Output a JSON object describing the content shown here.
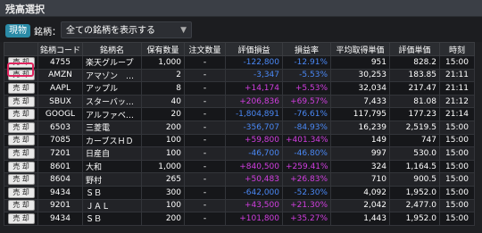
{
  "window": {
    "title": "残高選択"
  },
  "filter": {
    "badge": "現物",
    "label": "銘柄：",
    "selected": "全ての銘柄を表示する"
  },
  "columns": [
    "",
    "銘柄コード",
    "銘柄名",
    "保有数量",
    "注文数量",
    "評価損益",
    "損益率",
    "平均取得単価",
    "評価単価",
    "時刻"
  ],
  "sell_label": "売 却",
  "rows": [
    {
      "code": "4755",
      "name": "楽天グループ",
      "qty": "1,000",
      "order": "-",
      "pl": "-122,800",
      "rate": "-12.91%",
      "avg": "951",
      "eval": "828.2",
      "time": "15:00",
      "sign": "neg"
    },
    {
      "code": "AMZN",
      "name": "アマゾン　…",
      "qty": "2",
      "order": "-",
      "pl": "-3,347",
      "rate": "-5.53%",
      "avg": "30,253",
      "eval": "183.85",
      "time": "21:11",
      "sign": "neg"
    },
    {
      "code": "AAPL",
      "name": "アップル",
      "qty": "8",
      "order": "-",
      "pl": "+14,174",
      "rate": "+5.53%",
      "avg": "32,034",
      "eval": "217.47",
      "time": "21:11",
      "sign": "pos"
    },
    {
      "code": "SBUX",
      "name": "スターバッ…",
      "qty": "40",
      "order": "-",
      "pl": "+206,836",
      "rate": "+69.57%",
      "avg": "7,433",
      "eval": "81.08",
      "time": "21:12",
      "sign": "pos"
    },
    {
      "code": "GOOGL",
      "name": "アルファベ…",
      "qty": "20",
      "order": "-",
      "pl": "-1,804,891",
      "rate": "-76.61%",
      "avg": "117,795",
      "eval": "177.23",
      "time": "21:14",
      "sign": "neg"
    },
    {
      "code": "6503",
      "name": "三菱電",
      "qty": "200",
      "order": "-",
      "pl": "-356,707",
      "rate": "-84.93%",
      "avg": "16,239",
      "eval": "2,519.5",
      "time": "15:00",
      "sign": "neg"
    },
    {
      "code": "7085",
      "name": "カーブスＨＤ",
      "qty": "100",
      "order": "-",
      "pl": "+59,800",
      "rate": "+401.34%",
      "avg": "149",
      "eval": "747",
      "time": "15:00",
      "sign": "pos"
    },
    {
      "code": "7201",
      "name": "日産自",
      "qty": "100",
      "order": "-",
      "pl": "-46,700",
      "rate": "-46.80%",
      "avg": "997",
      "eval": "530.0",
      "time": "15:00",
      "sign": "neg"
    },
    {
      "code": "8601",
      "name": "大和",
      "qty": "1,000",
      "order": "-",
      "pl": "+840,500",
      "rate": "+259.41%",
      "avg": "324",
      "eval": "1,164.5",
      "time": "15:00",
      "sign": "pos"
    },
    {
      "code": "8604",
      "name": "野村",
      "qty": "265",
      "order": "-",
      "pl": "+50,483",
      "rate": "+26.83%",
      "avg": "710",
      "eval": "900.5",
      "time": "15:00",
      "sign": "pos"
    },
    {
      "code": "9434",
      "name": "ＳＢ",
      "qty": "300",
      "order": "-",
      "pl": "-642,000",
      "rate": "-52.30%",
      "avg": "4,092",
      "eval": "1,952.0",
      "time": "15:00",
      "sign": "neg"
    },
    {
      "code": "9201",
      "name": "ＪＡＬ",
      "qty": "100",
      "order": "-",
      "pl": "+43,500",
      "rate": "+21.30%",
      "avg": "2,042",
      "eval": "2,477.0",
      "time": "15:00",
      "sign": "pos"
    },
    {
      "code": "9434",
      "name": "ＳＢ",
      "qty": "200",
      "order": "-",
      "pl": "+101,800",
      "rate": "+35.27%",
      "avg": "1,443",
      "eval": "1,952.0",
      "time": "15:00",
      "sign": "pos"
    }
  ],
  "colors": {
    "positive": "#d23ee0",
    "negative": "#4a88f5",
    "highlight": "#e0245e",
    "badge": "#2a8aa6"
  }
}
